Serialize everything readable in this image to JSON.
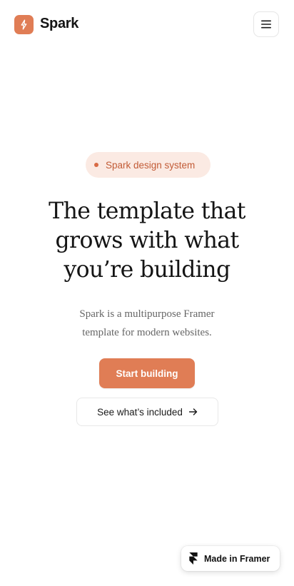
{
  "header": {
    "brand": "Spark",
    "logo_icon": "spark-logo-icon",
    "menu_icon": "hamburger-menu-icon"
  },
  "hero": {
    "badge": "Spark design system",
    "title_lines": [
      "The template that",
      "grows with what",
      "you’re building"
    ],
    "subtitle_lines": [
      "Spark is a multipurpose Framer",
      "template for modern websites."
    ],
    "primary_cta": "Start building",
    "secondary_cta": "See what’s included",
    "secondary_icon": "arrow-right-icon"
  },
  "framer_badge": {
    "label": "Made in Framer",
    "icon": "framer-logo-icon"
  },
  "colors": {
    "accent": "#e07d55",
    "badge_bg": "#fbeae3",
    "badge_text": "#c25b36",
    "text": "#141414",
    "muted": "#666666"
  }
}
